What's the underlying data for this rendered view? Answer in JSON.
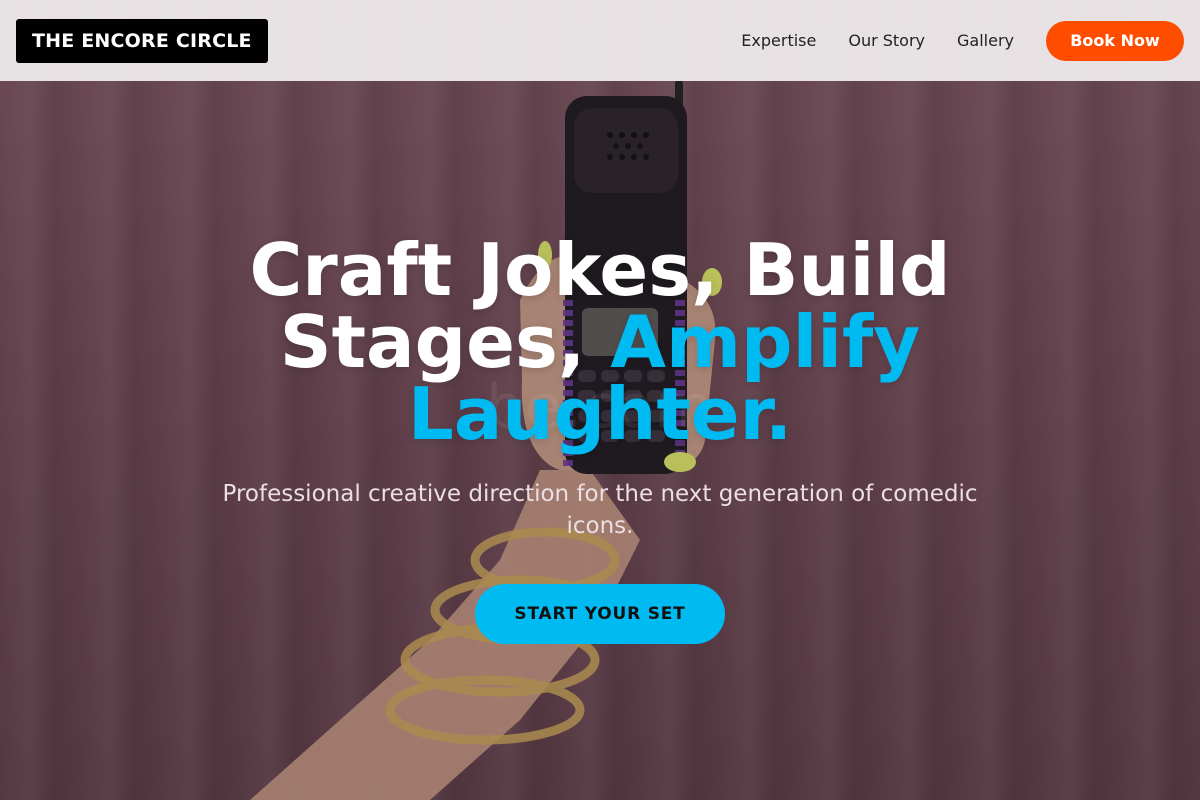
{
  "nav": {
    "brand": "THE ENCORE CIRCLE",
    "links": [
      "Expertise",
      "Our Story",
      "Gallery"
    ],
    "cta_label": "Book Now"
  },
  "hero": {
    "headline_part1": "Craft Jokes, Build Stages, ",
    "headline_accent": "Amplify Laughter.",
    "subtitle": "Professional creative direction for the next generation of comedic icons.",
    "cta_label": "START YOUR SET",
    "watermark": "be.com"
  },
  "colors": {
    "accent": "#00bbf2",
    "book_button": "#ff4d00",
    "brand_bg": "#000000",
    "nav_bg": "#eeeaec"
  },
  "icons": [
    "hand-holding-phone-illustration"
  ]
}
